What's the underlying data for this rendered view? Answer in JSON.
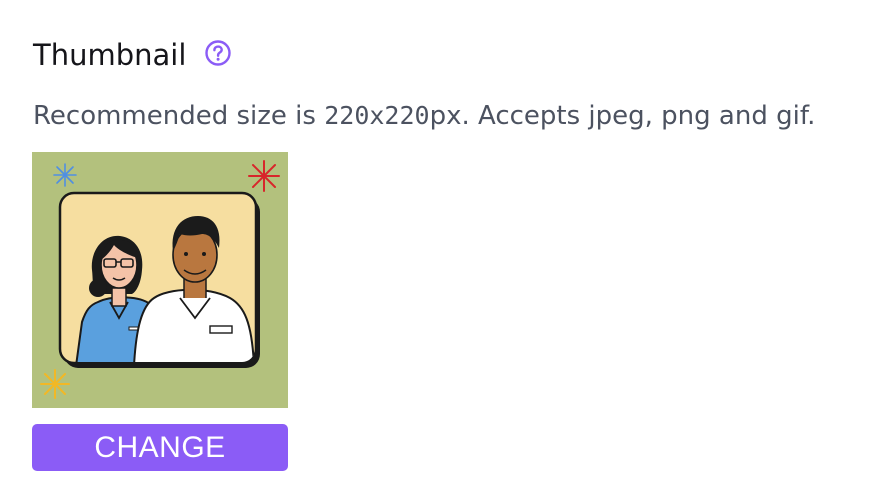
{
  "section": {
    "title": "Thumbnail",
    "help_icon": "question-circle-icon",
    "description_prefix": "Recommended size is ",
    "description_size": "220x220",
    "description_suffix": "px. Accepts jpeg, png and gif."
  },
  "thumbnail": {
    "background_color": "#b3c17d",
    "frame_color": "#f6dea0"
  },
  "actions": {
    "change_label": "CHANGE",
    "button_color": "#8b5cf6"
  }
}
